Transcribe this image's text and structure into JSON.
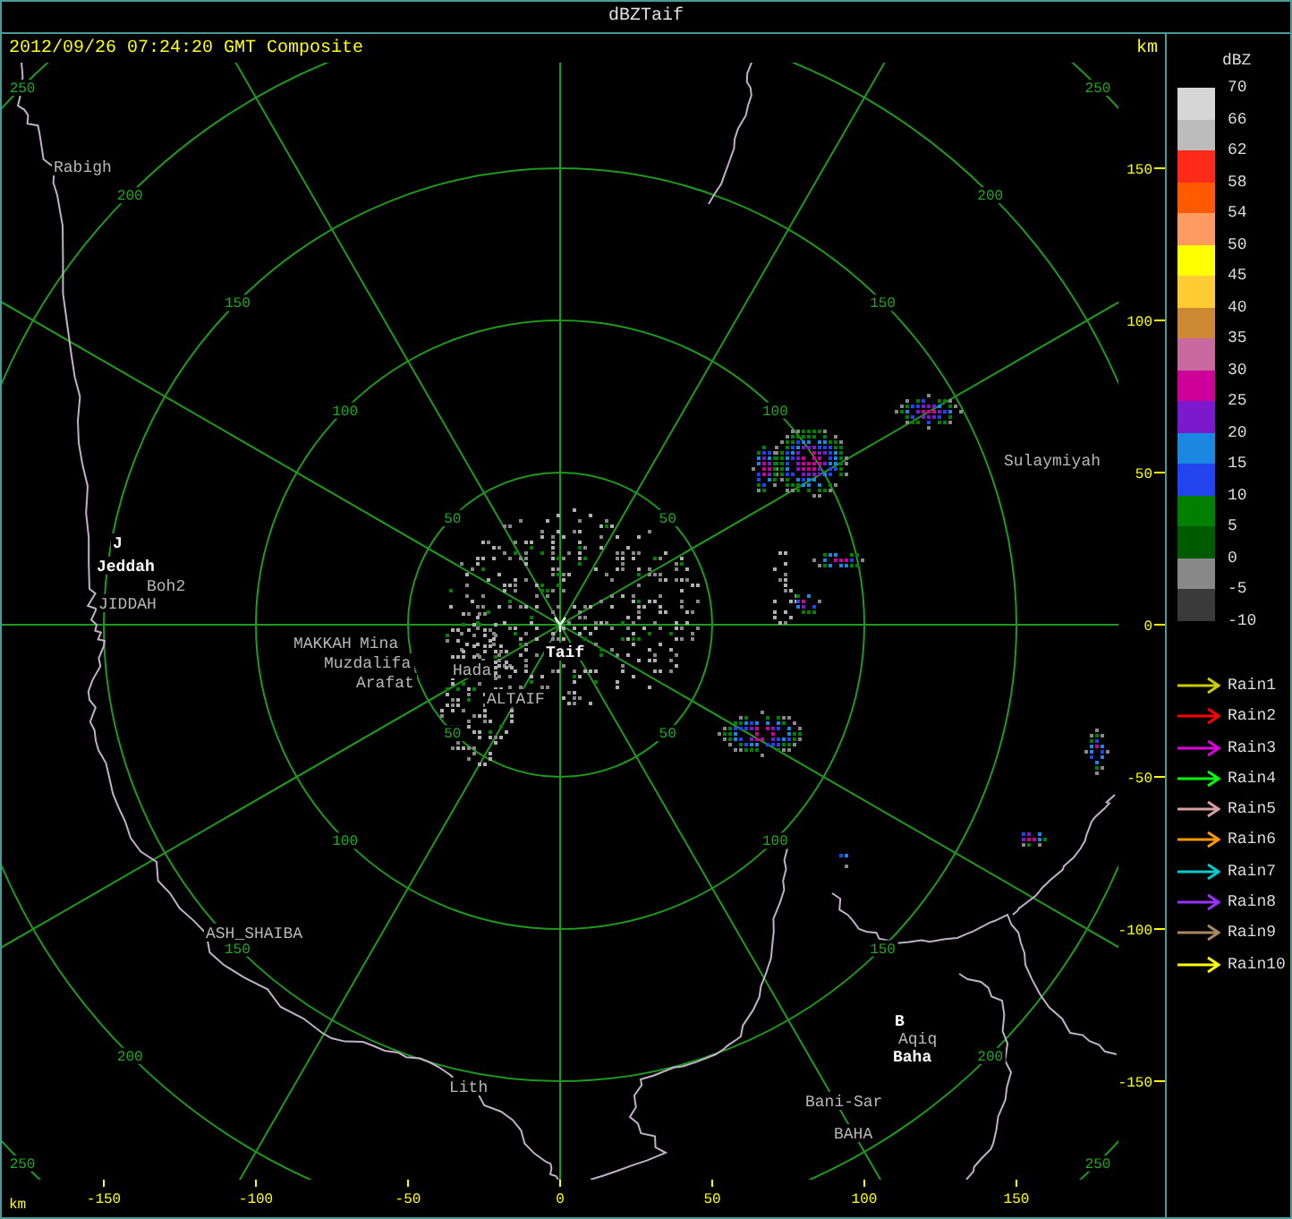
{
  "window": {
    "title": "dBZTaif"
  },
  "header": {
    "timestamp": "2012/09/26 07:24:20 GMT Composite",
    "unit": "km"
  },
  "map": {
    "rings": [
      {
        "labels": [
          "50",
          "50",
          "50",
          "50"
        ]
      },
      {
        "labels": [
          "100",
          "100",
          "100",
          "100"
        ]
      },
      {
        "labels": [
          "150",
          "150",
          "150",
          "150"
        ]
      },
      {
        "labels": [
          "200",
          "200",
          "200",
          "200"
        ]
      },
      {
        "labels": [
          "250",
          "250",
          "250",
          "250"
        ]
      }
    ],
    "places": [
      {
        "name": "Rabigh",
        "kind": "minor"
      },
      {
        "name": "Sulaymiyah",
        "kind": "minor"
      },
      {
        "name": "J",
        "kind": "city"
      },
      {
        "name": "Jeddah",
        "kind": "city"
      },
      {
        "name": "Boh2",
        "kind": "minor"
      },
      {
        "name": "JIDDAH",
        "kind": "minor"
      },
      {
        "name": "MAKKAH",
        "kind": "minor"
      },
      {
        "name": "Mina",
        "kind": "minor"
      },
      {
        "name": "Taif",
        "kind": "city"
      },
      {
        "name": "Muzdalifa",
        "kind": "minor"
      },
      {
        "name": "Hada",
        "kind": "minor"
      },
      {
        "name": "Arafat",
        "kind": "minor"
      },
      {
        "name": "ALTAIF",
        "kind": "minor"
      },
      {
        "name": "ASH_SHAIBA",
        "kind": "minor"
      },
      {
        "name": "B",
        "kind": "city"
      },
      {
        "name": "Aqiq",
        "kind": "minor"
      },
      {
        "name": "Baha",
        "kind": "city"
      },
      {
        "name": "Lith",
        "kind": "minor"
      },
      {
        "name": "Bani-Sar",
        "kind": "minor"
      },
      {
        "name": "BAHA",
        "kind": "minor"
      }
    ]
  },
  "y_axis": {
    "ticks": [
      "150",
      "100",
      "50",
      "0",
      "-50",
      "-100",
      "-150"
    ]
  },
  "x_axis": {
    "unit": "km",
    "ticks": [
      "-150",
      "-100",
      "-50",
      "0",
      "50",
      "100",
      "150"
    ]
  },
  "legend": {
    "title": "dBZ",
    "min_label": "-10",
    "scale": [
      {
        "label": "70",
        "color": "#d6d6d6"
      },
      {
        "label": "66",
        "color": "#bcbcbc"
      },
      {
        "label": "62",
        "color": "#ff2a1a"
      },
      {
        "label": "58",
        "color": "#ff5a00"
      },
      {
        "label": "54",
        "color": "#ff9a60"
      },
      {
        "label": "50",
        "color": "#ffff00"
      },
      {
        "label": "45",
        "color": "#ffcc33"
      },
      {
        "label": "40",
        "color": "#cc8833"
      },
      {
        "label": "35",
        "color": "#c86aa0"
      },
      {
        "label": "30",
        "color": "#cc0099"
      },
      {
        "label": "25",
        "color": "#7a1acc"
      },
      {
        "label": "20",
        "color": "#1a88e0"
      },
      {
        "label": "15",
        "color": "#2244ee"
      },
      {
        "label": "10",
        "color": "#008000"
      },
      {
        "label": "5",
        "color": "#005a00"
      },
      {
        "label": "0",
        "color": "#888888"
      },
      {
        "label": "-5",
        "color": "#3a3a3a"
      }
    ],
    "tracks": [
      {
        "label": "Rain1",
        "color": "#cccc00"
      },
      {
        "label": "Rain2",
        "color": "#ff0000"
      },
      {
        "label": "Rain3",
        "color": "#dd00dd"
      },
      {
        "label": "Rain4",
        "color": "#00ff00"
      },
      {
        "label": "Rain5",
        "color": "#d8a0a0"
      },
      {
        "label": "Rain6",
        "color": "#ff9900"
      },
      {
        "label": "Rain7",
        "color": "#00cccc"
      },
      {
        "label": "Rain8",
        "color": "#9933ff"
      },
      {
        "label": "Rain9",
        "color": "#aa8866"
      },
      {
        "label": "Rain10",
        "color": "#ffff00"
      }
    ]
  }
}
